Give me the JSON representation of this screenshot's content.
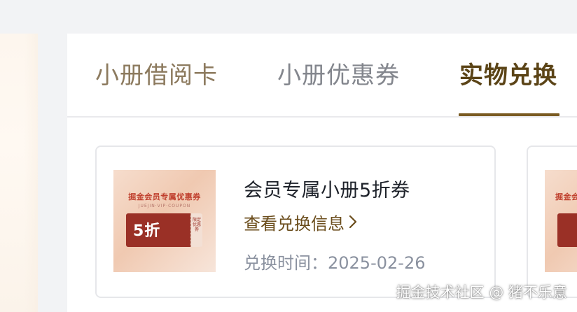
{
  "tabs": [
    {
      "label": "小册借阅卡",
      "active": false
    },
    {
      "label": "小册优惠券",
      "active": false
    },
    {
      "label": "实物兑换",
      "active": true
    }
  ],
  "coupon": {
    "name": "会员专属小册5折券",
    "link_label": "查看兑换信息",
    "date_label": "兑换时间：",
    "date_value": "2025-02-26",
    "thumb": {
      "title": "掘金会员专属优惠券",
      "subtitle": "JUEJIN·VIP·COUPON",
      "discount": "5折",
      "stub_text": "限定优惠券"
    }
  },
  "next_coupon_thumb": {
    "title": "掘金会"
  },
  "watermark": "掘金技术社区 @ 猪不乐意",
  "colors": {
    "accent": "#7a5b22",
    "active_tab_text": "#5b4417",
    "inactive_tab_text_1": "#8c7a5e",
    "inactive_tab_text_2": "#83868d",
    "ticket_red": "#9a3026"
  },
  "icons": {
    "link_arrow": "chevron-right-icon"
  }
}
